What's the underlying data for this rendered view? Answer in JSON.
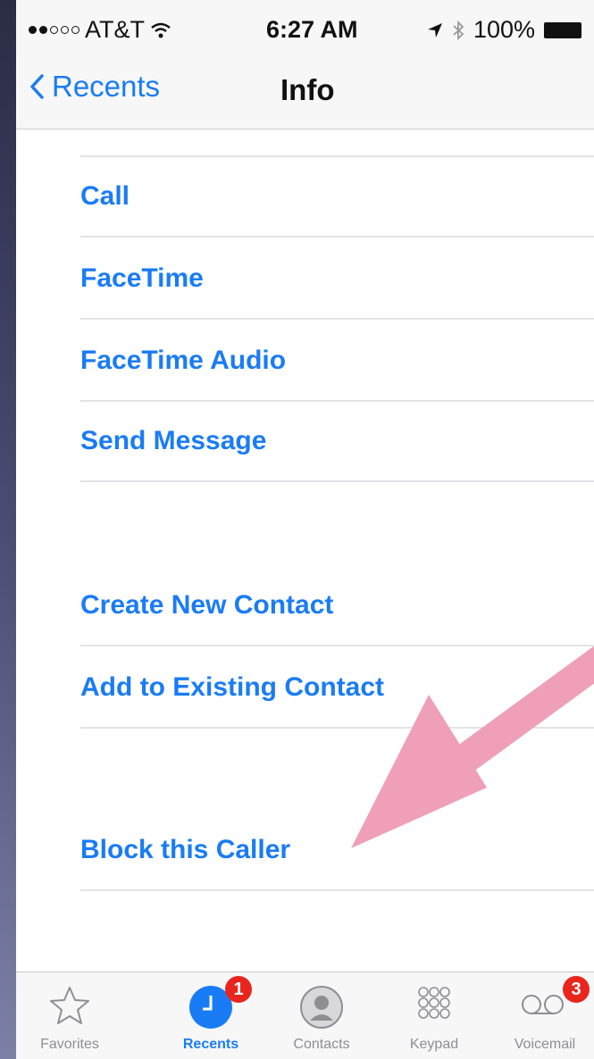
{
  "status": {
    "carrier": "AT&T",
    "time": "6:27 AM",
    "battery": "100%"
  },
  "nav": {
    "back_label": "Recents",
    "title": "Info"
  },
  "actions": {
    "call": "Call",
    "facetime": "FaceTime",
    "facetime_audio": "FaceTime Audio",
    "send_message": "Send Message",
    "create_contact": "Create New Contact",
    "add_existing": "Add to Existing Contact",
    "block": "Block this Caller"
  },
  "tabs": [
    {
      "label": "Favorites",
      "icon": "star-icon"
    },
    {
      "label": "Recents",
      "icon": "clock-icon",
      "badge": "1",
      "active": true
    },
    {
      "label": "Contacts",
      "icon": "person-icon"
    },
    {
      "label": "Keypad",
      "icon": "keypad-icon"
    },
    {
      "label": "Voicemail",
      "icon": "voicemail-icon",
      "badge": "3"
    }
  ],
  "colors": {
    "accent": "#1a7cf5",
    "annotation_arrow": "#ef9fb8",
    "badge": "#e8261d"
  }
}
